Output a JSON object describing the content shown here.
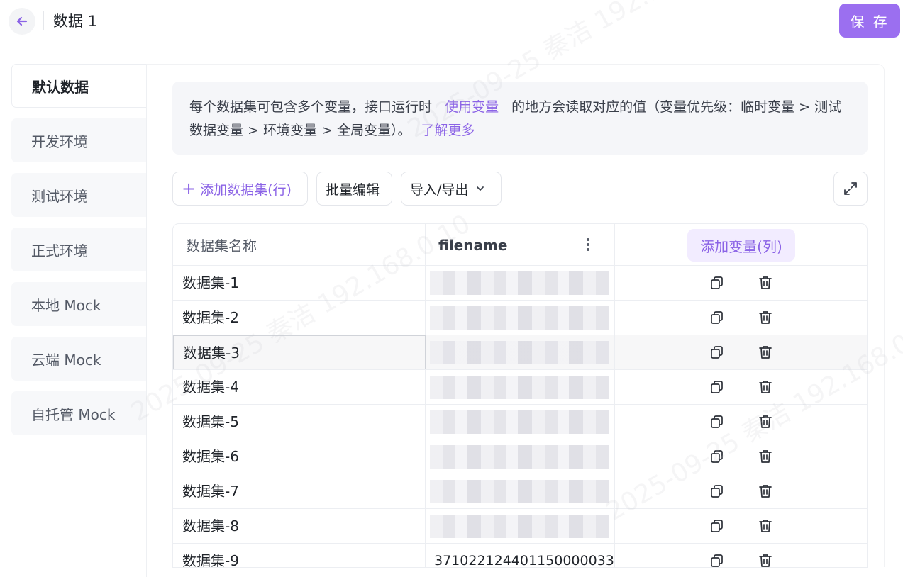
{
  "header": {
    "title": "数据 1",
    "save_label": "保 存"
  },
  "sidebar": {
    "items": [
      {
        "label": "默认数据",
        "active": true
      },
      {
        "label": "开发环境"
      },
      {
        "label": "测试环境"
      },
      {
        "label": "正式环境"
      },
      {
        "label": "本地 Mock"
      },
      {
        "label": "云端 Mock"
      },
      {
        "label": "自托管 Mock"
      }
    ]
  },
  "tip": {
    "text_before": "每个数据集可包含多个变量，接口运行时",
    "link_use_var": "使用变量",
    "text_middle": "的地方会读取对应的值（变量优先级：临时变量 > 测试数据变量 > 环境变量 > 全局变量）。",
    "link_learn_more": "了解更多"
  },
  "toolbar": {
    "add_dataset": "添加数据集(行)",
    "batch_edit": "批量编辑",
    "import_export": "导入/导出"
  },
  "table": {
    "columns": {
      "name": "数据集名称",
      "file": "filename",
      "add_var": "添加变量(列)"
    },
    "rows": [
      {
        "name": "数据集-1",
        "file": ""
      },
      {
        "name": "数据集-2",
        "file": ""
      },
      {
        "name": "数据集-3",
        "file": "",
        "selected": true
      },
      {
        "name": "数据集-4",
        "file": ""
      },
      {
        "name": "数据集-5",
        "file": ""
      },
      {
        "name": "数据集-6",
        "file": ""
      },
      {
        "name": "数据集-7",
        "file": ""
      },
      {
        "name": "数据集-8",
        "file": ""
      },
      {
        "name": "数据集-9",
        "file": "371022124401150000033"
      }
    ]
  },
  "watermark": "2025-09-25 秦洁 192.168.0.10",
  "colors": {
    "accent": "#9b6ff0",
    "link": "#8b63e6",
    "add_var_bg": "#f2ecff"
  }
}
